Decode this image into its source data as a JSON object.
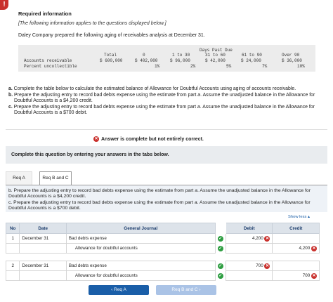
{
  "header": {
    "title": "Required information",
    "note": "[The following information applies to the questions displayed below.]",
    "intro": "Daley Company prepared the following aging of receivables analysis at December 31."
  },
  "aging": {
    "days_past_due": "Days Past Due",
    "col_total": "Total",
    "col_0": "0",
    "col_1_30": "1 to 30",
    "col_31_60": "31 to 60",
    "col_61_90": "61 to 90",
    "col_over_90": "Over 90",
    "row1_label": "Accounts receivable",
    "row1_total": "$ 600,000",
    "row1_0": "$ 402,000",
    "row1_1_30": "$ 96,000",
    "row1_31_60": "$ 42,000",
    "row1_61_90": "$ 24,000",
    "row1_over_90": "$ 36,000",
    "row2_label": "Percent uncollectible",
    "row2_0": "1%",
    "row2_1_30": "2%",
    "row2_31_60": "5%",
    "row2_61_90": "7%",
    "row2_over_90": "10%"
  },
  "questions": {
    "a_label": "a.",
    "a_text": "Complete the table below to calculate the estimated balance of Allowance for Doubtful Accounts using aging of accounts receivable.",
    "b_label": "b.",
    "b_text_1": "Prepare the adjusting entry to record bad debts expense using the estimate from part ",
    "b_text_em": "a",
    "b_text_2": ". Assume the unadjusted balance in the Allowance for Doubtful Accounts is a $4,200 credit.",
    "c_label": "c.",
    "c_text_1": "Prepare the adjusting entry to record bad debts expense using the estimate from part ",
    "c_text_em": "a",
    "c_text_2": ". Assume the unadjusted balance in the Allowance for Doubtful Accounts is a $700 debit."
  },
  "status": {
    "answer": "Answer is complete but not entirely correct.",
    "x_glyph": "✕",
    "complete_prompt": "Complete this question by entering your answers in the tabs below."
  },
  "tabs": [
    {
      "label": "Req A"
    },
    {
      "label": "Req B and C"
    }
  ],
  "part": {
    "b_1": "b. Prepare the adjusting entry to record bad debts expense using the estimate from part ",
    "b_em": "a",
    "b_2": ". Assume the unadjusted balance in the Allowance for Doubtful Accounts is a $4,200 credit.",
    "c_1": "c. Prepare the adjusting entry to record bad debts expense using the estimate from part ",
    "c_em": "a",
    "c_2": ". Assume the unadjusted balance in the Allowance for Doubtful Accounts is a $700 debit."
  },
  "show_less": "Show less ▴",
  "journal": {
    "headers": {
      "no": "No",
      "date": "Date",
      "account": "General Journal",
      "debit": "Debit",
      "credit": "Credit"
    },
    "rows": [
      {
        "no": "1",
        "date": "December 31",
        "account": "Bad debts expense",
        "debit": "4,200",
        "credit": ""
      },
      {
        "no": "",
        "date": "",
        "account": "Allowance for doubtful accounts",
        "debit": "",
        "credit": "4,200"
      },
      {
        "no": "2",
        "date": "December 31",
        "account": "Bad debts expense",
        "debit": "700",
        "credit": ""
      },
      {
        "no": "",
        "date": "",
        "account": "Allowance for doubtful accounts",
        "debit": "",
        "credit": "700"
      }
    ],
    "check_glyph": "✓"
  },
  "nav": {
    "prev": "‹  Req A",
    "next": "Req B and C  ›"
  },
  "colors": {
    "accent": "#1a5ea8",
    "error": "#c9302c",
    "success": "#2e9e41"
  }
}
